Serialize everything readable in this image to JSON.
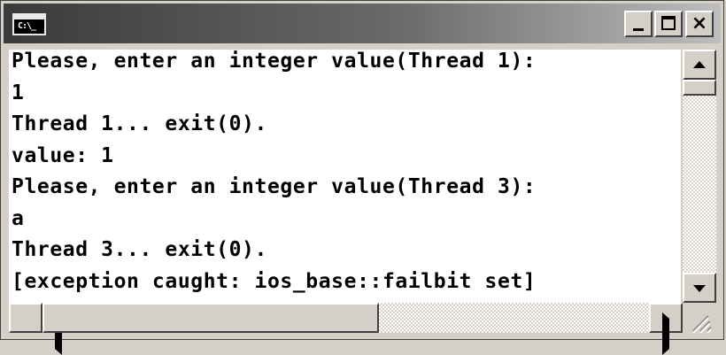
{
  "window": {
    "icon_label": "C:\\_",
    "icon_name": "console-icon",
    "buttons": {
      "minimize": "minimize-icon",
      "maximize": "maximize-icon",
      "close": "×"
    }
  },
  "console": {
    "lines": [
      "Please, enter an integer value(Thread 1):",
      "1",
      "Thread 1... exit(0).",
      "value: 1",
      "Please, enter an integer value(Thread 3):",
      "a",
      "Thread 3... exit(0).",
      "[exception caught: ios_base::failbit set]"
    ]
  },
  "colors": {
    "console_bg": "#ffffff",
    "console_text": "#000000",
    "chrome": "#d4d0c8"
  }
}
